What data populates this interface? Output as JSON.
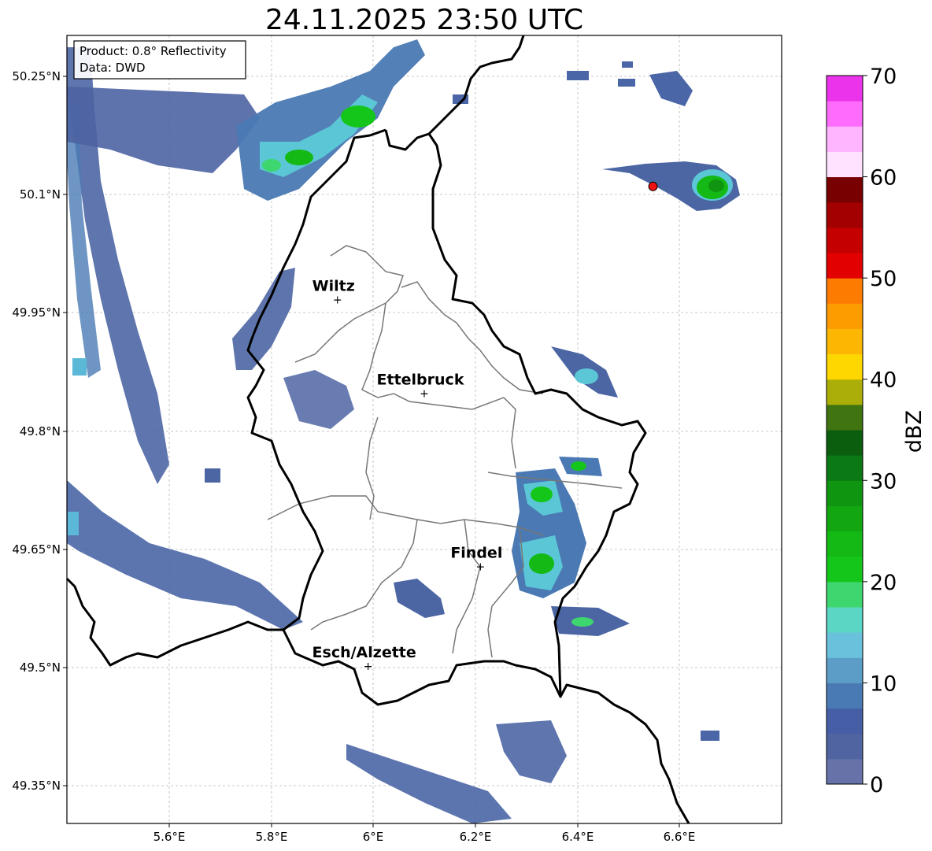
{
  "title": "24.11.2025 23:50 UTC",
  "info_box": {
    "product": "Product: 0.8° Reflectivity",
    "data": "Data: DWD"
  },
  "axes": {
    "x_ticks": [
      "5.6°E",
      "5.8°E",
      "6°E",
      "6.2°E",
      "6.4°E",
      "6.6°E"
    ],
    "y_ticks": [
      "50.25°N",
      "50.1°N",
      "49.95°N",
      "49.8°N",
      "49.65°N",
      "49.5°N",
      "49.35°N"
    ]
  },
  "cities": [
    {
      "name": "Wiltz",
      "lon": 5.93,
      "lat": 49.966
    },
    {
      "name": "Ettelbruck",
      "lon": 6.1,
      "lat": 49.847
    },
    {
      "name": "Findel",
      "lon": 6.21,
      "lat": 49.627
    },
    {
      "name": "Esch/Alzette",
      "lon": 5.99,
      "lat": 49.5
    }
  ],
  "radar_site": {
    "lon": 6.548,
    "lat": 50.11,
    "color": "#ee1111"
  },
  "colorbar": {
    "label": "dBZ",
    "min": 0,
    "max": 70,
    "ticks": [
      "0",
      "10",
      "20",
      "30",
      "40",
      "50",
      "60",
      "70"
    ],
    "colors": [
      "#6672a8",
      "#4f64a0",
      "#455ea6",
      "#4a7ab4",
      "#5b9dc6",
      "#69c1dc",
      "#5bd6c4",
      "#3ed66e",
      "#15c61a",
      "#14b915",
      "#12a710",
      "#0f9510",
      "#0c7a14",
      "#0a5e0e",
      "#3f7410",
      "#abae08",
      "#fed600",
      "#fdb703",
      "#fd9c00",
      "#fd7b00",
      "#e30001",
      "#c40001",
      "#a30001",
      "#780001",
      "#ffe2ff",
      "#ffb5ff",
      "#ff6cfd",
      "#ea33ea"
    ]
  }
}
